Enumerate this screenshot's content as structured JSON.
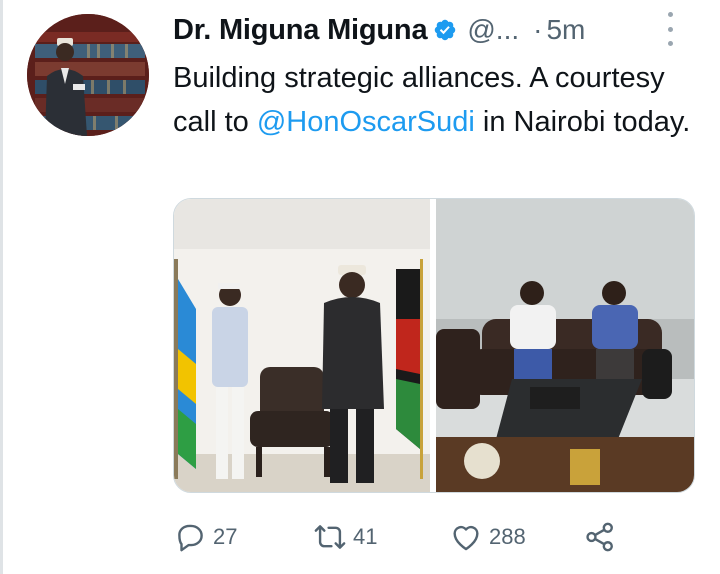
{
  "tweet": {
    "author_name": "Dr. Miguna Miguna",
    "handle": "@...",
    "separator": "·",
    "time": "5m",
    "text_before": "Building strategic alliances. A courtesy call to ",
    "mention": "@HonOscarSudi",
    "text_after": "  in Nairobi today."
  },
  "media": [
    {
      "description_icon": "photo"
    },
    {
      "description_icon": "photo"
    }
  ],
  "actions": {
    "reply_count": "27",
    "retweet_count": "41",
    "like_count": "288"
  },
  "colors": {
    "link": "#1d9bf0",
    "secondary_text": "#536471",
    "verified_badge": "#1d9bf0"
  },
  "icons": [
    "verified-badge-icon",
    "more-options-icon",
    "reply-icon",
    "retweet-icon",
    "like-icon",
    "share-icon"
  ]
}
